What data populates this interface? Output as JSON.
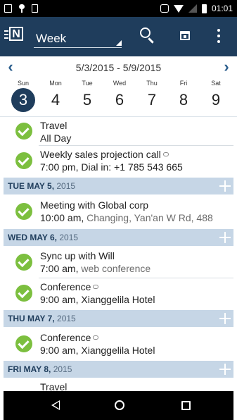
{
  "status_bar": {
    "time": "01:01"
  },
  "app_bar": {
    "view_label": "Week"
  },
  "week_nav": {
    "range": "5/3/2015 - 5/9/2015",
    "prev_symbol": "‹",
    "next_symbol": "›",
    "days": [
      {
        "dow": "Sun",
        "num": "3",
        "selected": true
      },
      {
        "dow": "Mon",
        "num": "4"
      },
      {
        "dow": "Tue",
        "num": "5"
      },
      {
        "dow": "Wed",
        "num": "6"
      },
      {
        "dow": "Thu",
        "num": "7"
      },
      {
        "dow": "Fri",
        "num": "8"
      },
      {
        "dow": "Sat",
        "num": "9"
      }
    ]
  },
  "agenda": {
    "events": [
      {
        "title": "Travel",
        "time": "All Day",
        "location": ""
      },
      {
        "title": "Weekly sales projection call",
        "time": "7:00 pm,",
        "location": "Dial in: +1 785 543 665"
      },
      {
        "title": "Meeting with Global corp",
        "time": "10:00 am,",
        "location": "Changing, Yan'an W Rd, 488"
      },
      {
        "title": "Sync up with Will",
        "time": "7:00 am,",
        "location": "web conference"
      },
      {
        "title": "Conference",
        "time": "9:00 am,",
        "location": "Xianggelila Hotel"
      },
      {
        "title": "Conference",
        "time": "9:00 am,",
        "location": "Xianggelila Hotel"
      },
      {
        "title": "Travel"
      }
    ],
    "day_headers": [
      {
        "label": "TUE MAY 5,",
        "year": "2015"
      },
      {
        "label": "WED MAY 6,",
        "year": "2015"
      },
      {
        "label": "THU MAY 7,",
        "year": "2015"
      },
      {
        "label": "FRI MAY 8,",
        "year": "2015"
      }
    ]
  },
  "colors": {
    "app_bar": "#1f3d5c",
    "day_header": "#c6d6e6",
    "check": "#7cbf3f",
    "accent_arrow": "#2a5d8c"
  }
}
